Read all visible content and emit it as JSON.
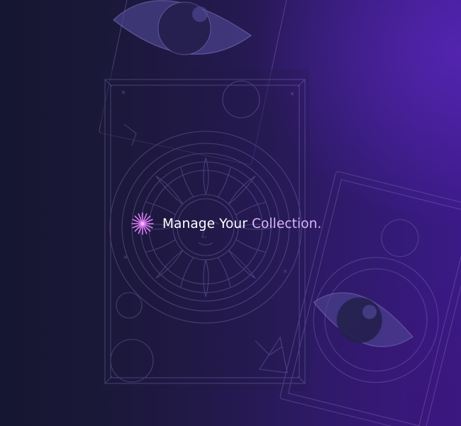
{
  "hero": {
    "title_part1": "Manage Your ",
    "title_part2": "Collection."
  },
  "icons": {
    "sparkle": "sparkle-icon",
    "background_eye": "eye-icon",
    "background_sun": "sun-icon"
  },
  "colors": {
    "bg_dark": "#151631",
    "bg_purple": "#3a1a86",
    "title_text": "#ffffff",
    "accent_text": "#d9b6f7",
    "sparkle": "#e07cf5",
    "line_art": "#8a7cc4"
  }
}
